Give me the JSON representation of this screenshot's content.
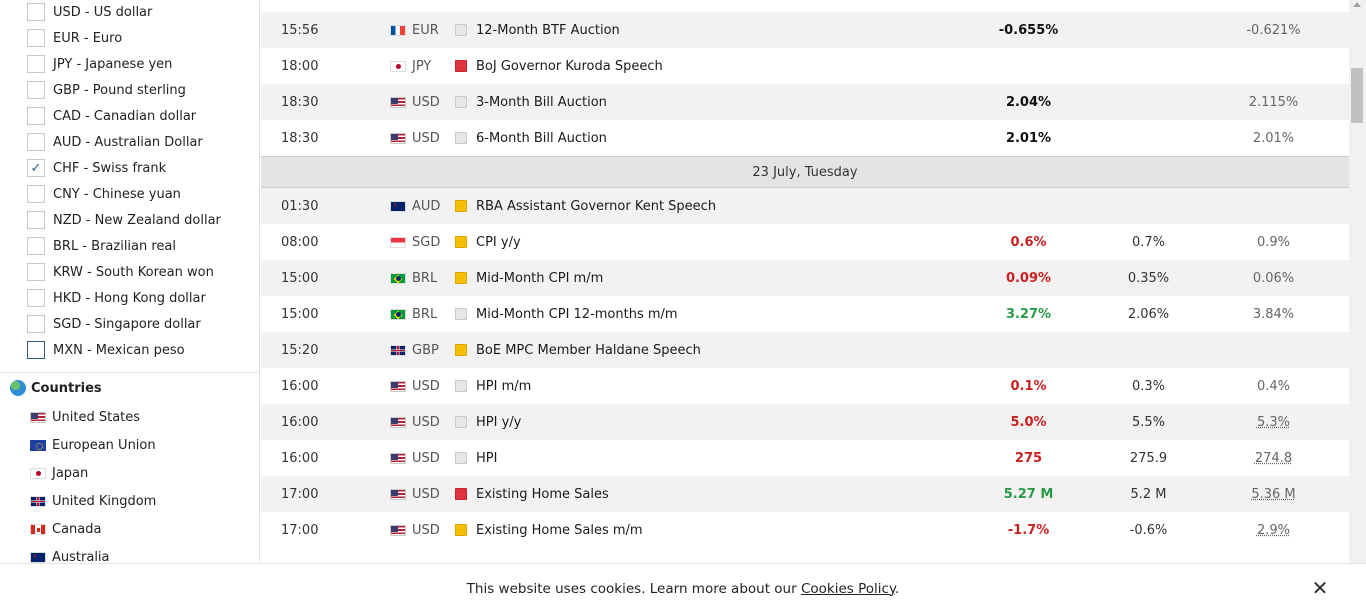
{
  "currencies": [
    {
      "label": "USD - US dollar",
      "checked": false
    },
    {
      "label": "EUR - Euro",
      "checked": false
    },
    {
      "label": "JPY - Japanese yen",
      "checked": false
    },
    {
      "label": "GBP - Pound sterling",
      "checked": false
    },
    {
      "label": "CAD - Canadian dollar",
      "checked": false
    },
    {
      "label": "AUD - Australian Dollar",
      "checked": false
    },
    {
      "label": "CHF - Swiss frank",
      "checked": true
    },
    {
      "label": "CNY - Chinese yuan",
      "checked": false
    },
    {
      "label": "NZD - New Zealand dollar",
      "checked": false
    },
    {
      "label": "BRL - Brazilian real",
      "checked": false
    },
    {
      "label": "KRW - South Korean won",
      "checked": false
    },
    {
      "label": "HKD - Hong Kong dollar",
      "checked": false
    },
    {
      "label": "SGD - Singapore dollar",
      "checked": false
    },
    {
      "label": "MXN - Mexican peso",
      "checked": false
    }
  ],
  "countries_heading": "Countries",
  "countries": [
    {
      "label": "United States",
      "flag": "us"
    },
    {
      "label": "European Union",
      "flag": "eu"
    },
    {
      "label": "Japan",
      "flag": "jp"
    },
    {
      "label": "United Kingdom",
      "flag": "gb"
    },
    {
      "label": "Canada",
      "flag": "ca"
    },
    {
      "label": "Australia",
      "flag": "au"
    }
  ],
  "events": [
    {
      "type": "event",
      "time": "15:56",
      "currency": "EUR",
      "flag": "fr",
      "importance": "low",
      "event": "12-Month BTF Auction",
      "actual": "-0.655%",
      "actual_tone": "neu",
      "forecast": "",
      "previous": "-0.621%",
      "revised": false
    },
    {
      "type": "event",
      "time": "18:00",
      "currency": "JPY",
      "flag": "jp",
      "importance": "high",
      "event": "BoJ Governor Kuroda Speech",
      "actual": "",
      "actual_tone": "neu",
      "forecast": "",
      "previous": "",
      "revised": false
    },
    {
      "type": "event",
      "time": "18:30",
      "currency": "USD",
      "flag": "us",
      "importance": "low",
      "event": "3-Month Bill Auction",
      "actual": "2.04%",
      "actual_tone": "neu",
      "forecast": "",
      "previous": "2.115%",
      "revised": false
    },
    {
      "type": "event",
      "time": "18:30",
      "currency": "USD",
      "flag": "us",
      "importance": "low",
      "event": "6-Month Bill Auction",
      "actual": "2.01%",
      "actual_tone": "neu",
      "forecast": "",
      "previous": "2.01%",
      "revised": false
    },
    {
      "type": "date",
      "label": "23 July, Tuesday"
    },
    {
      "type": "event",
      "time": "01:30",
      "currency": "AUD",
      "flag": "au",
      "importance": "medium",
      "event": "RBA Assistant Governor Kent Speech",
      "actual": "",
      "actual_tone": "neu",
      "forecast": "",
      "previous": "",
      "revised": false
    },
    {
      "type": "event",
      "time": "08:00",
      "currency": "SGD",
      "flag": "sg",
      "importance": "medium",
      "event": "CPI y/y",
      "actual": "0.6%",
      "actual_tone": "neg",
      "forecast": "0.7%",
      "previous": "0.9%",
      "revised": false
    },
    {
      "type": "event",
      "time": "15:00",
      "currency": "BRL",
      "flag": "br",
      "importance": "medium",
      "event": "Mid-Month CPI m/m",
      "actual": "0.09%",
      "actual_tone": "neg",
      "forecast": "0.35%",
      "previous": "0.06%",
      "revised": false
    },
    {
      "type": "event",
      "time": "15:00",
      "currency": "BRL",
      "flag": "br",
      "importance": "low",
      "event": "Mid-Month CPI 12-months m/m",
      "actual": "3.27%",
      "actual_tone": "pos",
      "forecast": "2.06%",
      "previous": "3.84%",
      "revised": false
    },
    {
      "type": "event",
      "time": "15:20",
      "currency": "GBP",
      "flag": "gb",
      "importance": "medium",
      "event": "BoE MPC Member Haldane Speech",
      "actual": "",
      "actual_tone": "neu",
      "forecast": "",
      "previous": "",
      "revised": false
    },
    {
      "type": "event",
      "time": "16:00",
      "currency": "USD",
      "flag": "us",
      "importance": "low",
      "event": "HPI m/m",
      "actual": "0.1%",
      "actual_tone": "neg",
      "forecast": "0.3%",
      "previous": "0.4%",
      "revised": false
    },
    {
      "type": "event",
      "time": "16:00",
      "currency": "USD",
      "flag": "us",
      "importance": "low",
      "event": "HPI y/y",
      "actual": "5.0%",
      "actual_tone": "neg",
      "forecast": "5.5%",
      "previous": "5.3%",
      "revised": true
    },
    {
      "type": "event",
      "time": "16:00",
      "currency": "USD",
      "flag": "us",
      "importance": "low",
      "event": "HPI",
      "actual": "275",
      "actual_tone": "neg",
      "forecast": "275.9",
      "previous": "274.8",
      "revised": true
    },
    {
      "type": "event",
      "time": "17:00",
      "currency": "USD",
      "flag": "us",
      "importance": "high",
      "event": "Existing Home Sales",
      "actual": "5.27 M",
      "actual_tone": "pos",
      "forecast": "5.2 M",
      "previous": "5.36 M",
      "revised": true
    },
    {
      "type": "event",
      "time": "17:00",
      "currency": "USD",
      "flag": "us",
      "importance": "medium",
      "event": "Existing Home Sales m/m",
      "actual": "-1.7%",
      "actual_tone": "neg",
      "forecast": "-0.6%",
      "previous": "2.9%",
      "revised": true
    }
  ],
  "cookie": {
    "text": "This website uses cookies. Learn more about our ",
    "link": "Cookies Policy",
    "suffix": ".",
    "close": "✕"
  }
}
